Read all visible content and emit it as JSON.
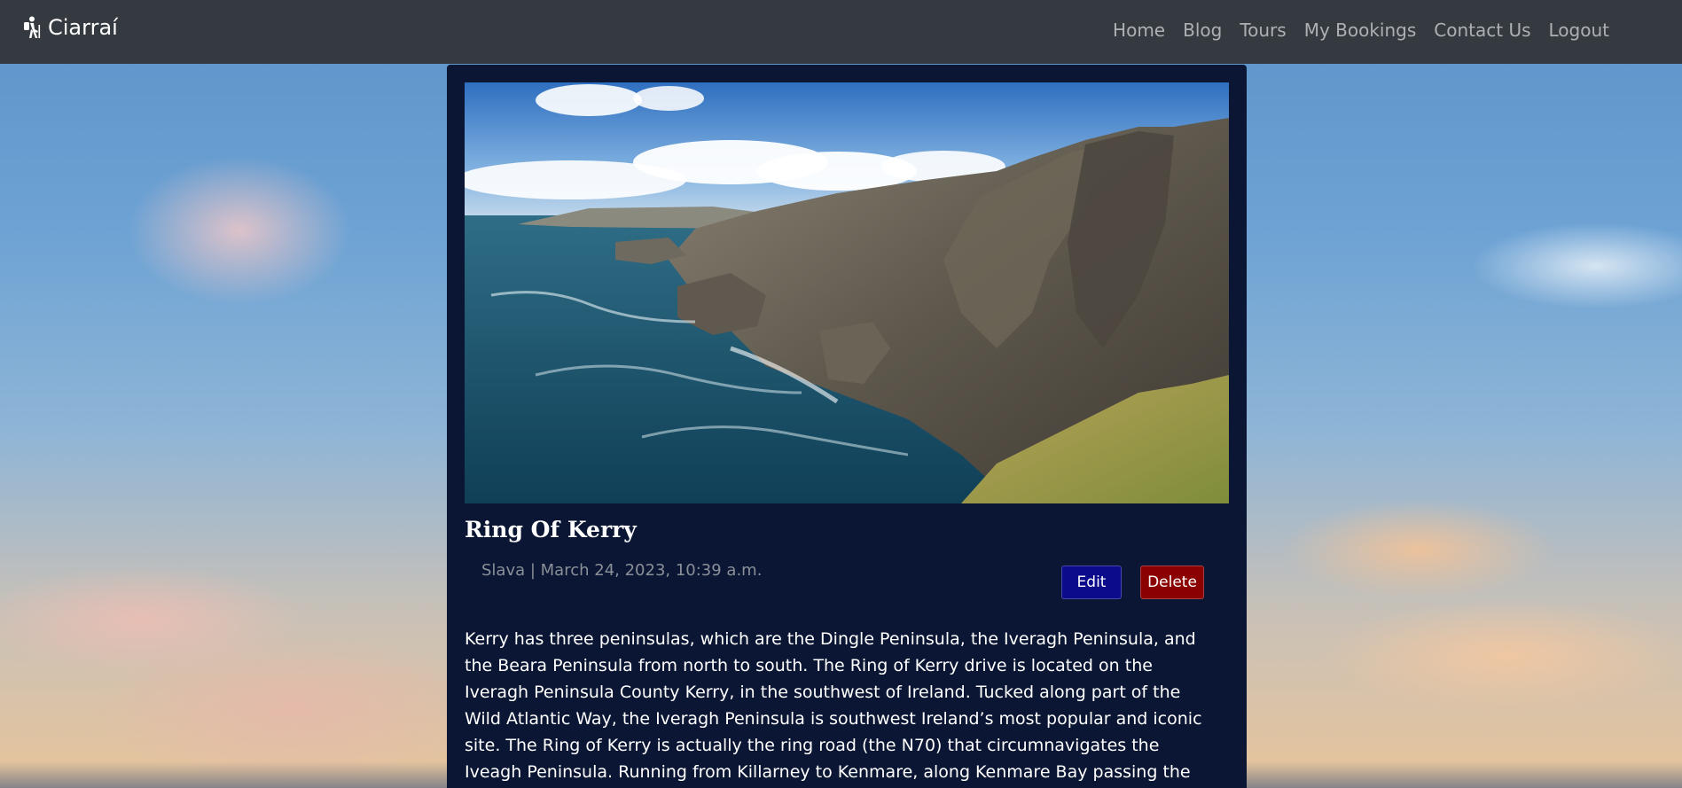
{
  "navbar": {
    "brand": "Ciarraí",
    "brand_icon": "hiking-icon",
    "links": [
      "Home",
      "Blog",
      "Tours",
      "My Bookings",
      "Contact Us",
      "Logout"
    ]
  },
  "post": {
    "title": "Ring Of Kerry",
    "meta": "Slava | March 24, 2023, 10:39 a.m.",
    "edit_label": "Edit",
    "delete_label": "Delete",
    "body": "Kerry has three peninsulas, which are the Dingle Peninsula, the Iveragh Peninsula, and the Beara Peninsula from north to south. The Ring of Kerry drive is located on the Iveragh Peninsula County Kerry, in the southwest of Ireland. Tucked along part of the Wild Atlantic Way, the Iveragh Peninsula is southwest Ireland’s most popular and iconic site. The Ring of Kerry is actually the ring road (the N70) that circumnavigates the Iveagh Peninsula. Running from Killarney to Kenmare, along Kenmare Bay passing the villages of Sneem and Caherdaniel, then heading north along the"
  },
  "colors": {
    "navbar": "#343a40",
    "card": "#0a1633",
    "edit_button": "#0b0b8c",
    "delete_button": "#8b0000"
  }
}
